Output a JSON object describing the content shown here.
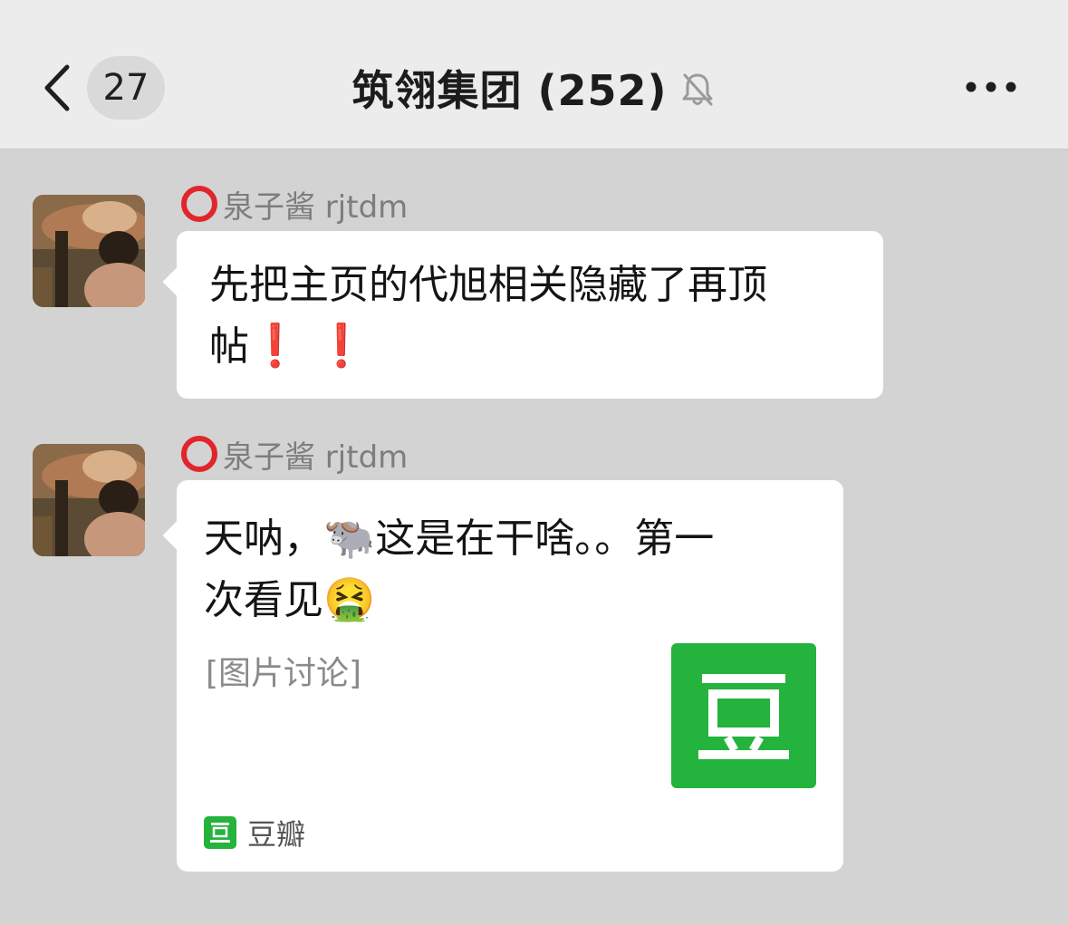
{
  "header": {
    "unread_count": "27",
    "title": "筑翎集团 (252)",
    "icons": {
      "back": "chevron-left-icon",
      "mute": "bell-off-icon",
      "more": "more-dots-icon"
    }
  },
  "messages": [
    {
      "sender": "泉子酱 rjtdm",
      "text_line1": "先把主页的代旭相关隐藏了再顶",
      "text_line2": "帖",
      "exclamations": "❗ ❗"
    },
    {
      "sender": "泉子酱 rjtdm",
      "text_line1_a": "天呐，",
      "emoji_ox": "🐃",
      "text_line1_b": "这是在干啥。。第一",
      "text_line2": "次看见",
      "emoji_vomit": "🤮",
      "card_subtitle": "[图片讨论]",
      "source_name": "豆瓣",
      "thumbnail_char": "豆"
    }
  ],
  "colors": {
    "background": "#d3d3d3",
    "header": "#ececec",
    "bubble": "#ffffff",
    "ring": "#e0262c",
    "douban_green": "#24b33c"
  }
}
